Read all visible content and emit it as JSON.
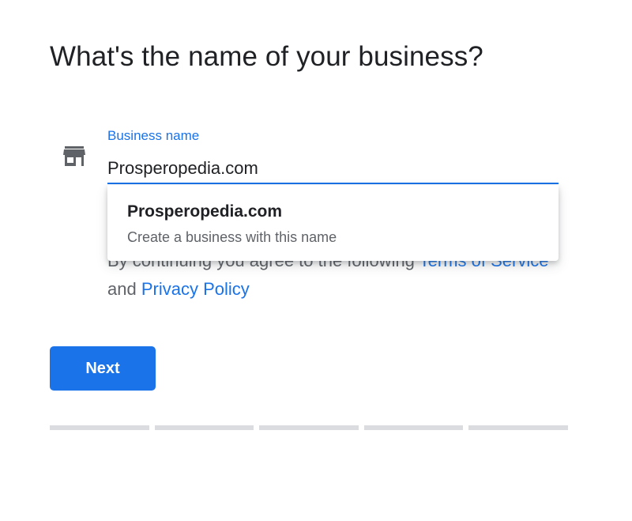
{
  "page": {
    "title": "What's the name of your business?"
  },
  "business_field": {
    "icon": "store-icon",
    "label": "Business name",
    "value": "Prosperopedia.com"
  },
  "autocomplete": {
    "items": [
      {
        "title": "Prosperopedia.com",
        "subtitle": "Create a business with this name"
      }
    ]
  },
  "terms": {
    "prefix": "By continuing you agree to the following ",
    "terms_link": "Terms of Service",
    "connector": " and ",
    "privacy_link": "Privacy Policy"
  },
  "actions": {
    "next_label": "Next"
  },
  "progress": {
    "steps_total": 5,
    "steps_completed": 0
  },
  "colors": {
    "accent": "#1a73e8",
    "progress_inactive": "#dadce0",
    "text_primary": "#202124",
    "text_secondary": "#5f6368"
  }
}
